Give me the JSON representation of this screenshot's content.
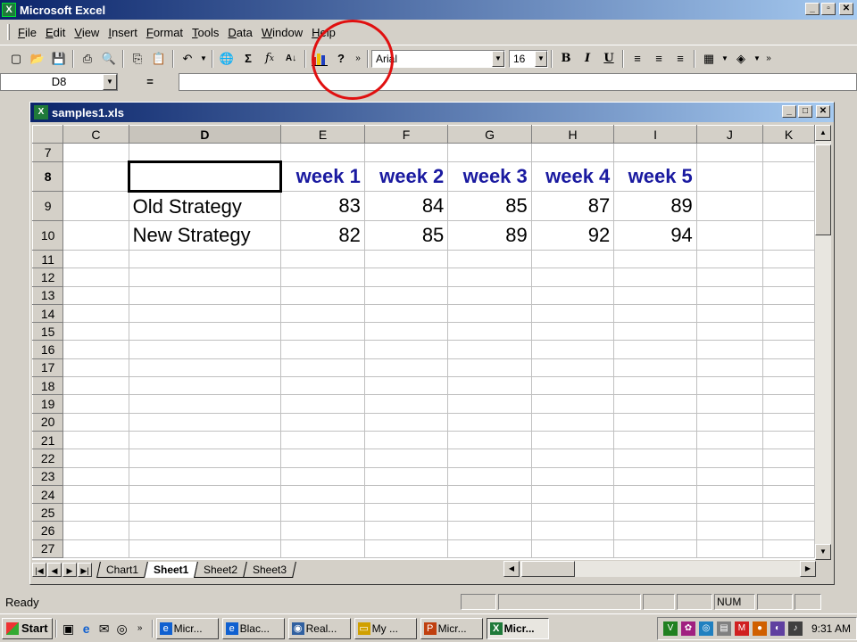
{
  "window": {
    "title": "Microsoft Excel"
  },
  "menu": [
    "File",
    "Edit",
    "View",
    "Insert",
    "Format",
    "Tools",
    "Data",
    "Window",
    "Help"
  ],
  "toolbar": {
    "font_name": "Arial",
    "font_size": "16"
  },
  "formula_bar": {
    "name_box": "D8",
    "equals": "=",
    "value": ""
  },
  "workbook": {
    "title": "samples1.xls"
  },
  "columns": [
    "C",
    "D",
    "E",
    "F",
    "G",
    "H",
    "I",
    "J",
    "K"
  ],
  "rows": [
    "7",
    "8",
    "9",
    "10",
    "11",
    "12",
    "13",
    "14",
    "15",
    "16",
    "17",
    "18",
    "19",
    "20",
    "21",
    "22",
    "23",
    "24",
    "25",
    "26",
    "27"
  ],
  "cells": {
    "headers": [
      "week 1",
      "week 2",
      "week 3",
      "week 4",
      "week 5"
    ],
    "old": {
      "label": "Old Strategy",
      "values": [
        "83",
        "84",
        "85",
        "87",
        "89"
      ]
    },
    "new": {
      "label": "New Strategy",
      "values": [
        "82",
        "85",
        "89",
        "92",
        "94"
      ]
    }
  },
  "tabs": [
    "Chart1",
    "Sheet1",
    "Sheet2",
    "Sheet3"
  ],
  "status": {
    "text": "Ready",
    "num": "NUM"
  },
  "taskbar": {
    "start": "Start",
    "tasks": [
      "Micr...",
      "Blac...",
      "Real...",
      "My ...",
      "Micr...",
      "Micr..."
    ],
    "clock": "9:31 AM"
  },
  "colors": {
    "header_text": "#1a1aa0",
    "annotation": "#e01010",
    "title_bar": "#0a246a"
  }
}
